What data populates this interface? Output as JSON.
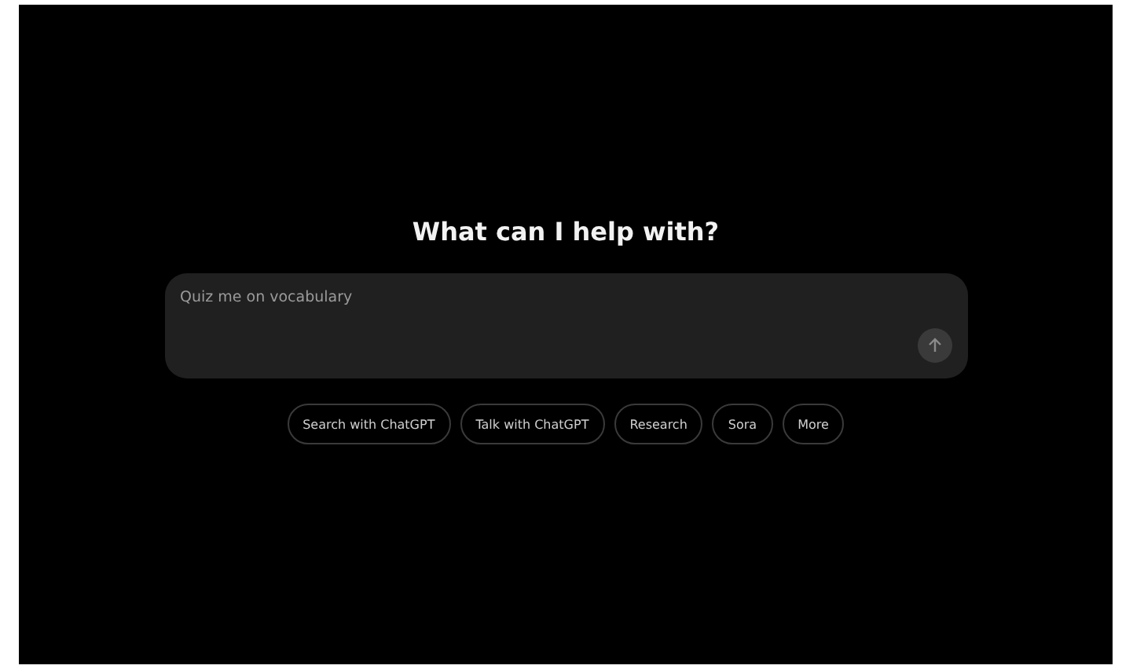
{
  "heading": "What can I help with?",
  "composer": {
    "placeholder": "Quiz me on vocabulary"
  },
  "actions": [
    {
      "label": "Search with ChatGPT"
    },
    {
      "label": "Talk with ChatGPT"
    },
    {
      "label": "Research"
    },
    {
      "label": "Sora"
    },
    {
      "label": "More"
    }
  ]
}
